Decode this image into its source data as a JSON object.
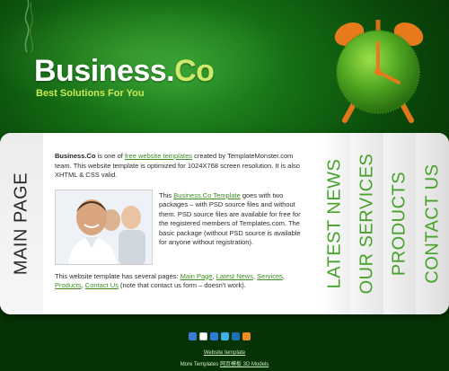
{
  "header": {
    "logo_main": "Business.",
    "logo_accent": "Co",
    "tagline": "Best Solutions For You"
  },
  "sidebar": {
    "main_tab": "MAIN PAGE"
  },
  "nav": {
    "items": [
      {
        "label": "LATEST NEWS"
      },
      {
        "label": "OUR SERVICES"
      },
      {
        "label": "PRODUCTS"
      },
      {
        "label": "CONTACT US"
      }
    ]
  },
  "content": {
    "intro_bold": "Business.Co",
    "intro_1": " is one of ",
    "intro_link": "free website templates",
    "intro_2": " created by TemplateMonster.com team. This website template is optimized for 1024X768 screen resolution. It is also XHTML & CSS valid.",
    "p2_1": "This ",
    "p2_link": "Business.Co Template",
    "p2_2": " goes with two packages – with PSD source files and without them. PSD source files are available for free for the registered members of Templates.com. The basic package (without PSD source is available for anyone without registration).",
    "p3_1": "This website template has several pages: ",
    "p3_links": [
      "Main Page",
      "Latest News",
      "Services",
      "Products",
      "Contact Us"
    ],
    "p3_2": " (note that contact us form – doesn't work)."
  },
  "footer": {
    "link": "Website template",
    "more_prefix": "More Templates ",
    "more_link": "网页模板 3D Models"
  },
  "colors": {
    "accent_green": "#47a22b",
    "link_green": "#3f8e24",
    "tagline_lime": "#c9ea58"
  },
  "icons": [
    "delicious-icon",
    "digg-icon",
    "stumbleupon-icon",
    "myspace-icon",
    "linkedin-icon",
    "rss-icon"
  ]
}
